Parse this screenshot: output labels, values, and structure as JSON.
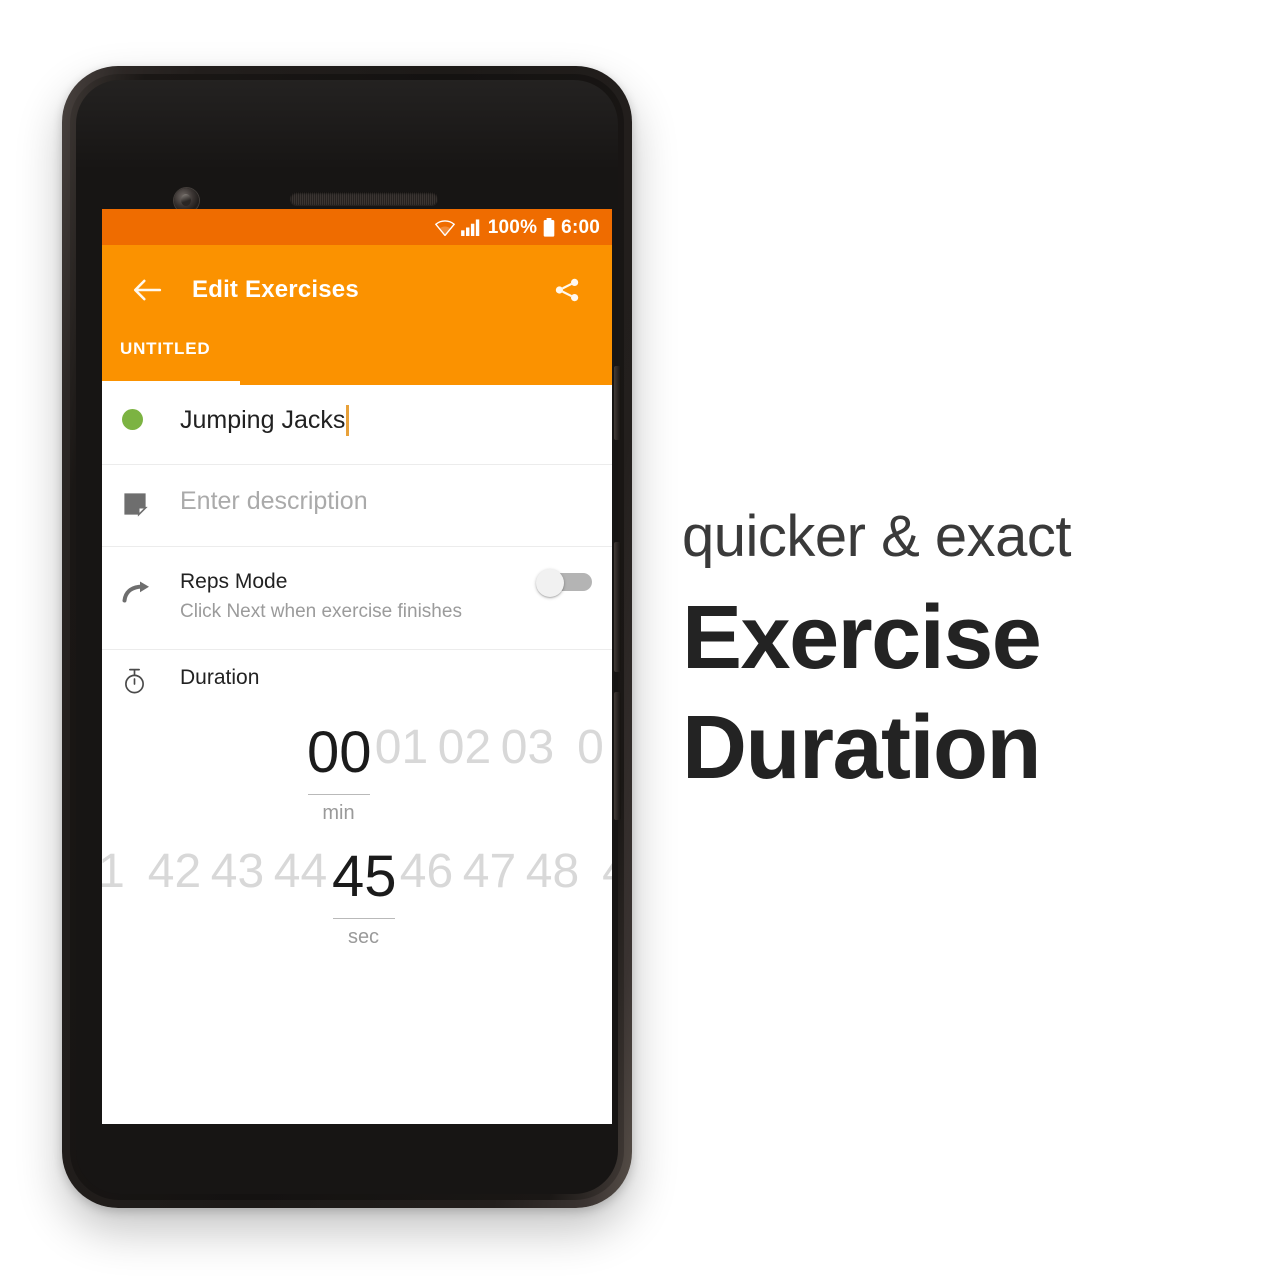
{
  "phone": {
    "hardware": {
      "front_camera": "front-camera",
      "earpiece": "earpiece-speaker",
      "sensor": "proximity-sensor"
    }
  },
  "statusbar": {
    "wifi_icon": "wifi-icon",
    "signal_icon": "cellular-signal-icon",
    "battery_percent": "100%",
    "battery_icon": "battery-full-icon",
    "time": "6:00"
  },
  "appbar": {
    "back_icon": "back-arrow-icon",
    "title": "Edit Exercises",
    "share_icon": "share-icon",
    "accent_color": "#fb9200",
    "statusbar_color": "#ef6c00"
  },
  "tabs": [
    {
      "label": "UNTITLED",
      "selected": true
    }
  ],
  "list": {
    "exercise_name": {
      "icon": "green-dot-icon",
      "icon_color": "#7cb342",
      "value": "Jumping Jacks",
      "has_caret": true,
      "caret_color": "#e8a13a"
    },
    "description": {
      "icon": "note-icon",
      "placeholder": "Enter description",
      "value": ""
    },
    "reps_mode": {
      "icon": "redo-arrow-icon",
      "title": "Reps Mode",
      "subtitle": "Click Next when exercise finishes",
      "toggle_state": "off"
    },
    "duration": {
      "icon": "stopwatch-icon",
      "title": "Duration"
    }
  },
  "duration_picker": {
    "minutes": {
      "unit_label": "min",
      "selected": "00",
      "items": [
        "00",
        "01",
        "02",
        "03",
        "0"
      ]
    },
    "seconds": {
      "unit_label": "sec",
      "selected": "45",
      "items": [
        "1",
        "42",
        "43",
        "44",
        "45",
        "46",
        "47",
        "48",
        "4"
      ]
    }
  },
  "marketing": {
    "lead": "quicker & exact",
    "line1": "Exercise",
    "line2": "Duration"
  }
}
